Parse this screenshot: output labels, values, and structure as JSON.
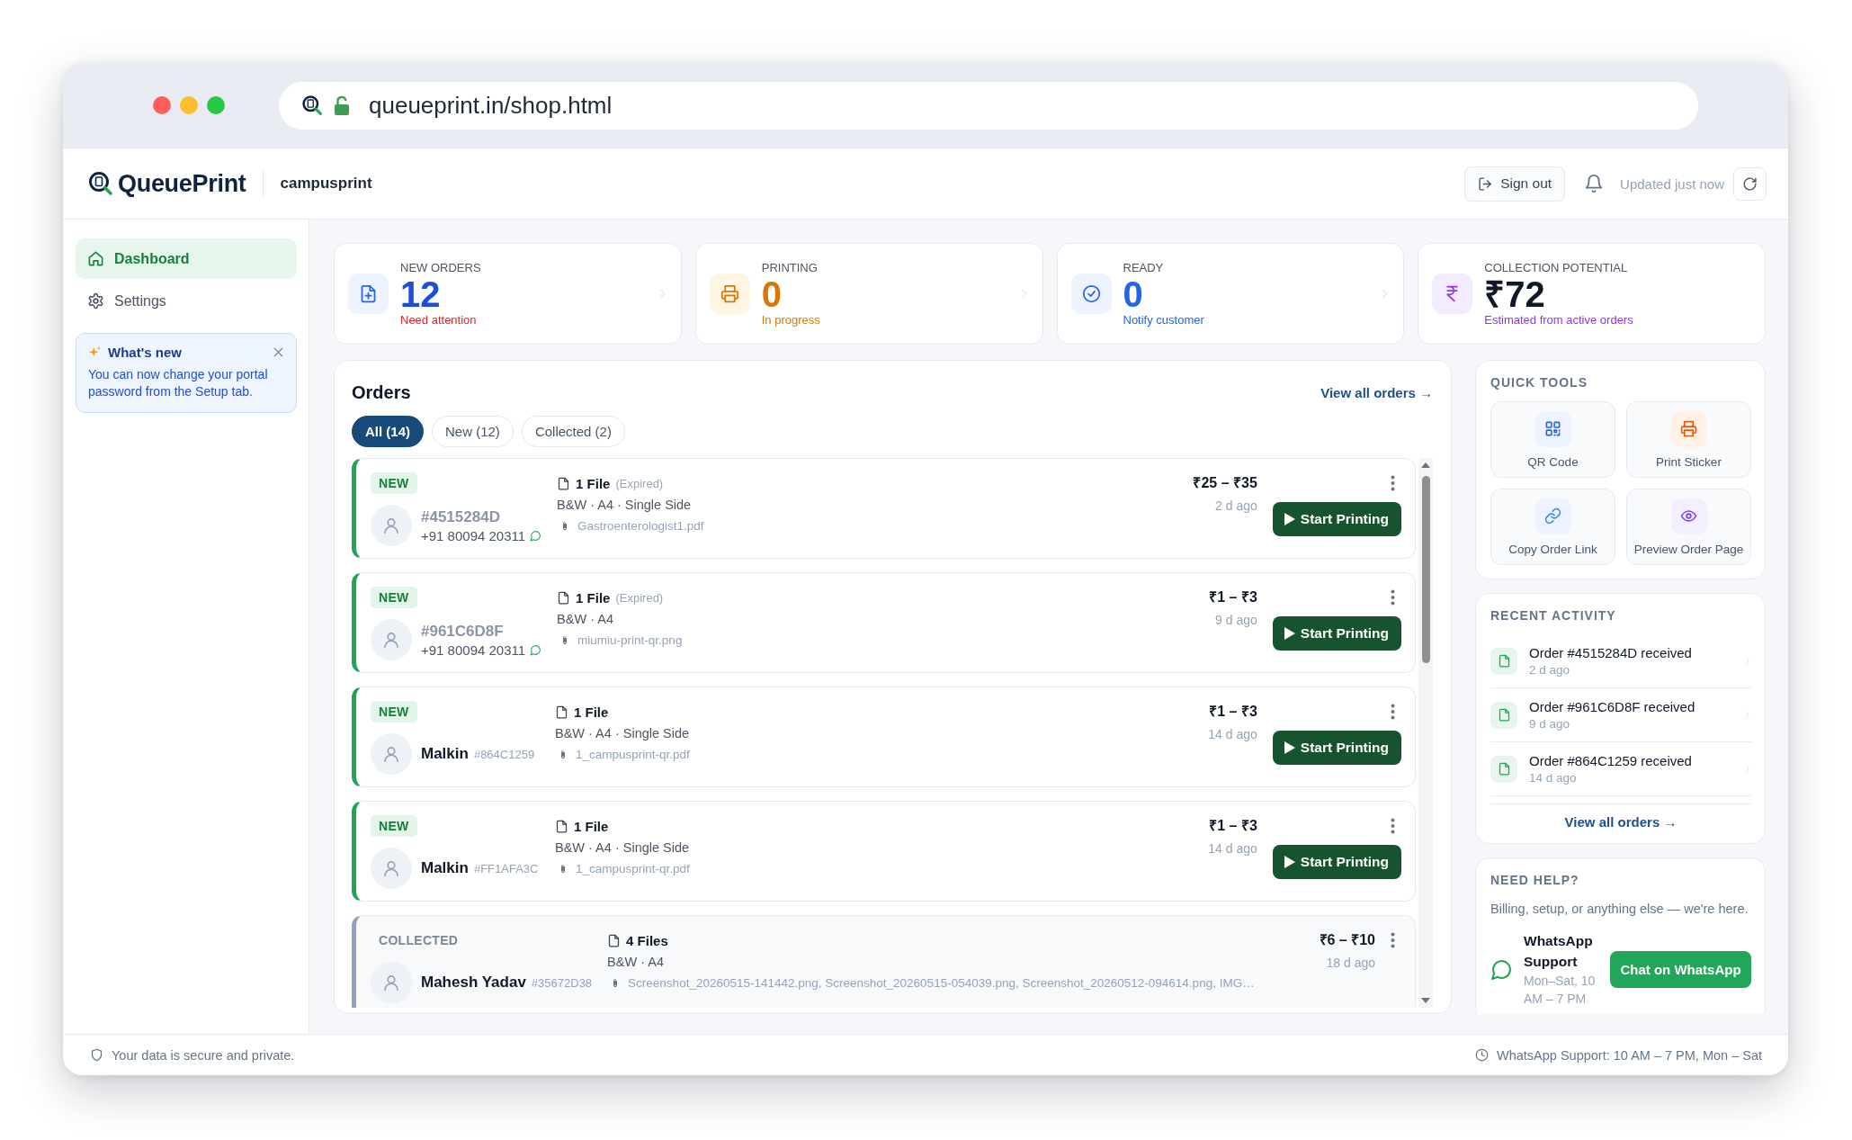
{
  "browser": {
    "url": "queueprint.in/shop.html"
  },
  "header": {
    "brand": "QueuePrint",
    "shop": "campusprint",
    "sign_out": "Sign out",
    "status": "Updated just now"
  },
  "sidebar": {
    "items": [
      {
        "kind": "home",
        "label": "Dashboard",
        "selected": true
      },
      {
        "kind": "settings",
        "label": "Settings",
        "selected": false
      }
    ],
    "notice": {
      "title": "What's new",
      "text": "You can now change your portal password from the Setup tab."
    }
  },
  "stats": [
    {
      "kind": "new_orders",
      "label": "NEW ORDERS",
      "value": "12",
      "note": "Need attention"
    },
    {
      "kind": "printing",
      "label": "PRINTING",
      "value": "0",
      "note": "In progress"
    },
    {
      "kind": "ready",
      "label": "READY",
      "value": "0",
      "note": "Notify customer"
    },
    {
      "kind": "collection",
      "label": "COLLECTION POTENTIAL",
      "value": "₹72",
      "note": "Estimated from active orders"
    }
  ],
  "orders": {
    "title": "Orders",
    "view_all": "View all orders →",
    "tabs": [
      {
        "label": "All (14)",
        "selected": true
      },
      {
        "label": "New (12)",
        "selected": false
      },
      {
        "label": "Collected (2)",
        "selected": false
      }
    ],
    "list": [
      {
        "kind": "new",
        "status": "NEW",
        "order_id": "#4515284D",
        "phone": "+91 80094 20311",
        "files": "1 File",
        "expired": "(Expired)",
        "specs": "B&W · A4 · Single Side",
        "filenames": "Gastroenterologist1.pdf",
        "price": "₹25 – ₹35",
        "age": "2 d ago",
        "action": "Start Printing"
      },
      {
        "kind": "new",
        "status": "NEW",
        "order_id": "#961C6D8F",
        "phone": "+91 80094 20311",
        "files": "1 File",
        "expired": "(Expired)",
        "specs": "B&W · A4",
        "filenames": "miumiu-print-qr.png",
        "price": "₹1 – ₹3",
        "age": "9 d ago",
        "action": "Start Printing"
      },
      {
        "kind": "new",
        "status": "NEW",
        "customer": "Malkin",
        "order_id": "#864C1259",
        "files": "1 File",
        "specs": "B&W · A4 · Single Side",
        "filenames": "1_campusprint-qr.pdf",
        "price": "₹1 – ₹3",
        "age": "14 d ago",
        "action": "Start Printing"
      },
      {
        "kind": "new",
        "status": "NEW",
        "customer": "Malkin",
        "order_id": "#FF1AFA3C",
        "files": "1 File",
        "specs": "B&W · A4 · Single Side",
        "filenames": "1_campusprint-qr.pdf",
        "price": "₹1 – ₹3",
        "age": "14 d ago",
        "action": "Start Printing"
      },
      {
        "kind": "collected",
        "status": "COLLECTED",
        "customer": "Mahesh Yadav",
        "order_id": "#35672D38",
        "files": "4 Files",
        "specs": "B&W · A4",
        "filenames": "Screenshot_20260515-141442.png, Screenshot_20260515-054039.png, Screenshot_20260512-094614.png, IMG…",
        "price": "₹6 – ₹10",
        "age": "18 d ago"
      }
    ]
  },
  "quick_tools": {
    "title": "QUICK TOOLS",
    "tools": [
      {
        "kind": "qr",
        "label": "QR Code"
      },
      {
        "kind": "sticker",
        "label": "Print Sticker"
      },
      {
        "kind": "link",
        "label": "Copy Order Link"
      },
      {
        "kind": "preview",
        "label": "Preview Order Page"
      }
    ]
  },
  "recent_activity": {
    "title": "RECENT ACTIVITY",
    "items": [
      {
        "text": "Order #4515284D received",
        "time": "2 d ago"
      },
      {
        "text": "Order #961C6D8F received",
        "time": "9 d ago"
      },
      {
        "text": "Order #864C1259 received",
        "time": "14 d ago"
      }
    ],
    "view_all": "View all orders →"
  },
  "help": {
    "title": "NEED HELP?",
    "text": "Billing, setup, or anything else — we're here.",
    "channel": "WhatsApp Support",
    "hours": "Mon–Sat, 10 AM – 7 PM",
    "button": "Chat on WhatsApp"
  },
  "footer": {
    "left": "Your data is secure and private.",
    "right": "WhatsApp Support: 10 AM – 7 PM, Mon – Sat"
  }
}
